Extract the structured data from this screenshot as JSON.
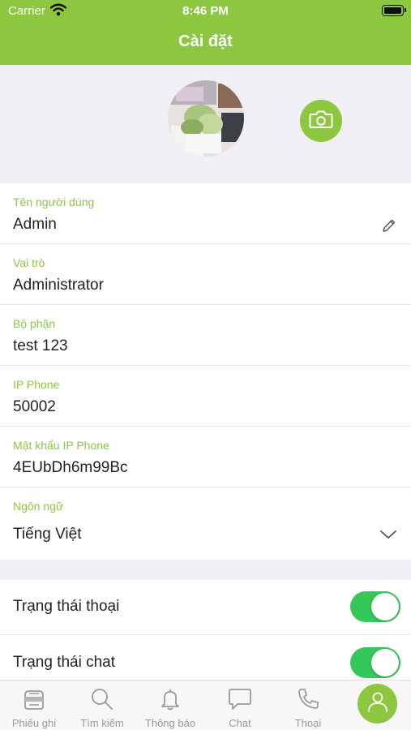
{
  "status_bar": {
    "carrier": "Carrier",
    "time": "8:46 PM"
  },
  "header": {
    "title": "Cài đặt"
  },
  "profile": {
    "avatar_icon": "user-photo",
    "camera_icon": "camera-icon"
  },
  "fields": [
    {
      "label": "Tên người dùng",
      "value": "Admin"
    },
    {
      "label": "Vai trò",
      "value": "Administrator"
    },
    {
      "label": "Bộ phận",
      "value": "test 123"
    },
    {
      "label": "IP Phone",
      "value": "50002"
    },
    {
      "label": "Mật khẩu IP Phone",
      "value": "4EUbDh6m99Bc"
    },
    {
      "label": "Ngôn ngữ",
      "value": "Tiếng Việt"
    }
  ],
  "toggles": [
    {
      "label": "Trạng thái thoại",
      "on": true
    },
    {
      "label": "Trạng thái chat",
      "on": true
    }
  ],
  "tabbar": {
    "tabs": [
      {
        "label": "Phiếu ghi",
        "icon": "ticket-icon"
      },
      {
        "label": "Tìm kiếm",
        "icon": "search-icon"
      },
      {
        "label": "Thông báo",
        "icon": "bell-icon"
      },
      {
        "label": "Chat",
        "icon": "chat-icon"
      },
      {
        "label": "Thoại",
        "icon": "phone-icon"
      }
    ],
    "active_icon": "profile-icon"
  },
  "colors": {
    "accent": "#8dc63f",
    "toggle_on": "#34c759",
    "section_bg": "#efeff4",
    "tab_inactive": "#9a9a9a"
  }
}
